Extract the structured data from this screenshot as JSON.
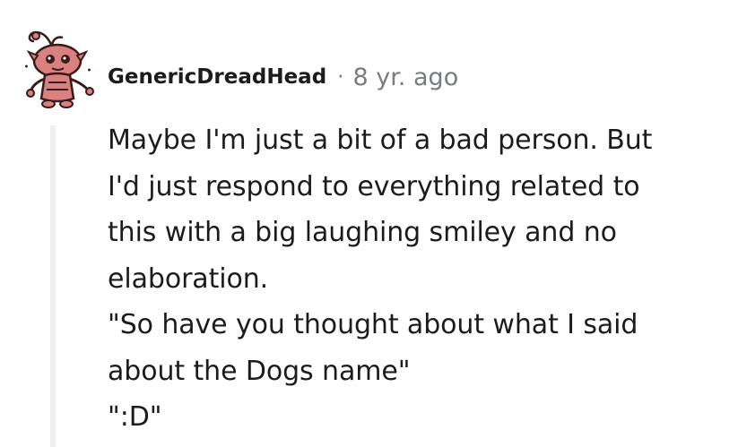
{
  "comment": {
    "author": "GenericDreadHead",
    "separator": "·",
    "timestamp": "8 yr. ago",
    "avatar_icon": "snoo-avatar-icon",
    "colors": {
      "avatar_primary": "#d98080",
      "avatar_outline": "#3a1a1a",
      "meta_grey": "#787c7e",
      "thread_line": "#edeff1"
    },
    "lines": [
      "Maybe I'm just a bit of a bad person. But",
      "I'd just respond to everything related to",
      "this with a big laughing smiley and no",
      "elaboration.",
      "\"So have you thought about what I said",
      "about the Dogs name\"",
      "\":D\""
    ]
  }
}
